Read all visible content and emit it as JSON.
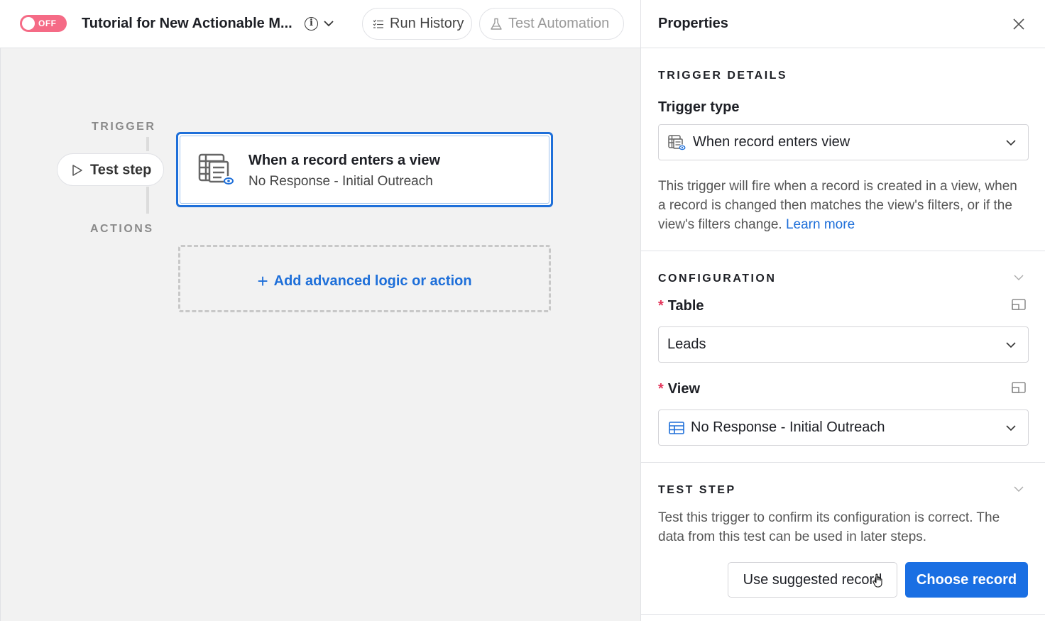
{
  "topbar": {
    "toggle_label": "OFF",
    "title": "Tutorial for New Actionable M...",
    "run_history": "Run History",
    "test_automation": "Test Automation"
  },
  "canvas": {
    "trigger_label": "TRIGGER",
    "actions_label": "ACTIONS",
    "test_step": "Test step",
    "trigger_card": {
      "title": "When a record enters a view",
      "subtitle": "No Response - Initial Outreach"
    },
    "add_action": "Add advanced logic or action"
  },
  "panel": {
    "title": "Properties",
    "trigger_details": {
      "section_title": "TRIGGER DETAILS",
      "trigger_type_label": "Trigger type",
      "trigger_type_value": "When record enters view",
      "description": "This trigger will fire when a record is created in a view, when a record is changed then matches the view's filters, or if the view's filters change.",
      "learn_more": "Learn more"
    },
    "configuration": {
      "section_title": "CONFIGURATION",
      "required_mark": "*",
      "table_label": "Table",
      "table_value": "Leads",
      "view_label": "View",
      "view_value": "No Response - Initial Outreach"
    },
    "test_step": {
      "section_title": "TEST STEP",
      "description": "Test this trigger to confirm its configuration is correct. The data from this test can be used in later steps.",
      "use_suggested": "Use suggested record",
      "choose_record": "Choose record"
    }
  },
  "colors": {
    "accent": "#1a6fe3",
    "toggle_off": "#f56b86",
    "required": "#e3345a",
    "canvas_bg": "#f2f2f2"
  }
}
